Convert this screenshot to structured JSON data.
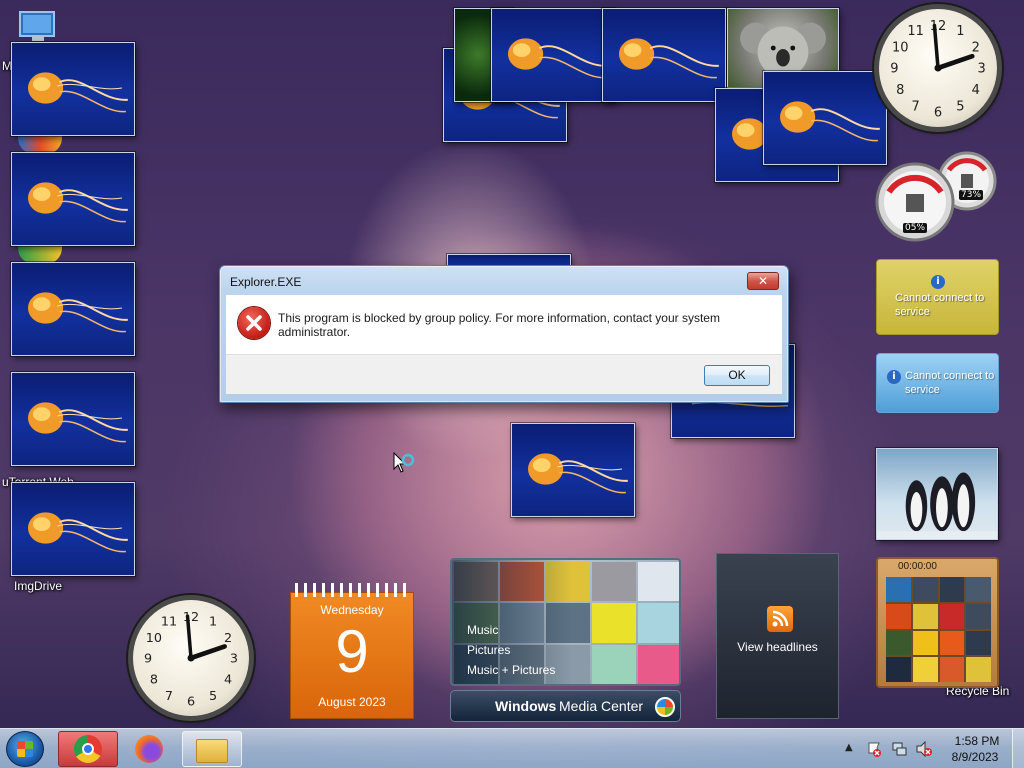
{
  "desktop": {
    "icons": [
      {
        "label": "M"
      },
      {
        "label": "uTorrent Web"
      },
      {
        "label": "ImgDrive"
      },
      {
        "label": "Recycle Bin"
      }
    ]
  },
  "dialog": {
    "title": "Explorer.EXE",
    "close_label": "✕",
    "message": "This program is blocked by group policy. For more information, contact your system administrator.",
    "ok_label": "OK"
  },
  "gadgets": {
    "weather_1": {
      "text": "Cannot connect to service"
    },
    "weather_2": {
      "text": "Cannot connect to service"
    },
    "cpu_meter": {
      "cpu": "05%",
      "memory": "73%"
    },
    "calendar": {
      "weekday": "Wednesday",
      "day": "9",
      "month_year": "August 2023"
    },
    "media_center": {
      "items": [
        "Music",
        "Pictures",
        "Music + Pictures"
      ],
      "brand_bold": "Windows",
      "brand_rest": " Media Center"
    },
    "feeds": {
      "label": "View headlines"
    },
    "puzzle": {
      "timer": "00:00:00"
    }
  },
  "taskbar": {
    "time": "1:58 PM",
    "date": "8/9/2023",
    "apps": [
      "start",
      "chrome",
      "firefox",
      "file-explorer"
    ]
  }
}
